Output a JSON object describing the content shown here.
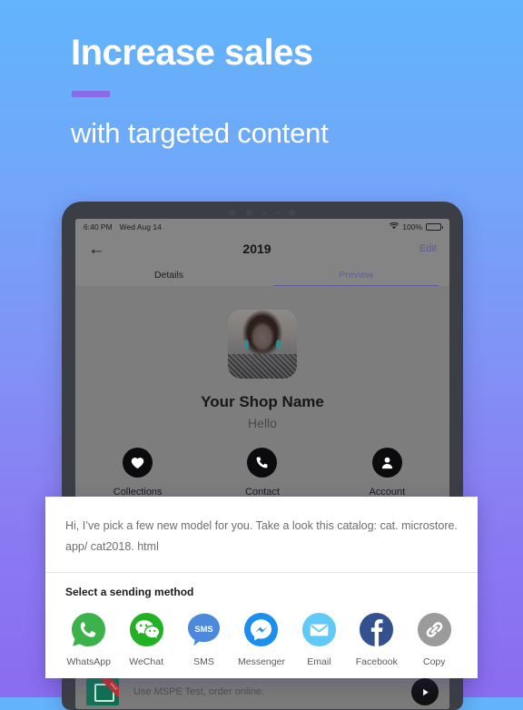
{
  "promo": {
    "title": "Increase sales",
    "subtitle": "with targeted content",
    "accent_color": "#8b6ae8"
  },
  "device": {
    "status_bar": {
      "time": "6:40 PM",
      "date": "Wed Aug 14",
      "wifi_icon": "wifi-icon",
      "battery_percent": "100%",
      "battery_icon": "battery-icon"
    },
    "navbar": {
      "back_icon": "arrow-left-icon",
      "title": "2019",
      "edit_label": "Edit"
    },
    "tabs": [
      {
        "label": "Details",
        "active": false
      },
      {
        "label": "Preview",
        "active": true
      }
    ],
    "preview": {
      "avatar_name": "shop-avatar",
      "shop_name": "Your Shop Name",
      "greeting": "Hello",
      "actions": [
        {
          "label": "Collections",
          "icon": "heart-icon"
        },
        {
          "label": "Contact",
          "icon": "phone-icon"
        },
        {
          "label": "Account",
          "icon": "person-icon"
        }
      ]
    },
    "bottom_strip": {
      "thumb_ribbon": "SALE",
      "text": "Use MSPE Test, order online.",
      "button_icon": "play-icon"
    }
  },
  "share_sheet": {
    "message": "Hi, I’ve pick a few new model for you. Take a look this catalog: cat. microstore. app/ cat2018. html",
    "subtitle": "Select a sending method",
    "options": [
      {
        "label": "WhatsApp",
        "icon": "whatsapp-icon",
        "color": "#3cb34a"
      },
      {
        "label": "WeChat",
        "icon": "wechat-icon",
        "color": "#22b123"
      },
      {
        "label": "SMS",
        "icon": "sms-icon",
        "color": "#4a89dc"
      },
      {
        "label": "Messenger",
        "icon": "messenger-icon",
        "color": "#1b8ef2"
      },
      {
        "label": "Email",
        "icon": "email-icon",
        "color": "#61c9f5"
      },
      {
        "label": "Facebook",
        "icon": "facebook-icon",
        "color": "#33508f"
      },
      {
        "label": "Copy",
        "icon": "link-icon",
        "color": "#9b9b9b"
      }
    ]
  }
}
